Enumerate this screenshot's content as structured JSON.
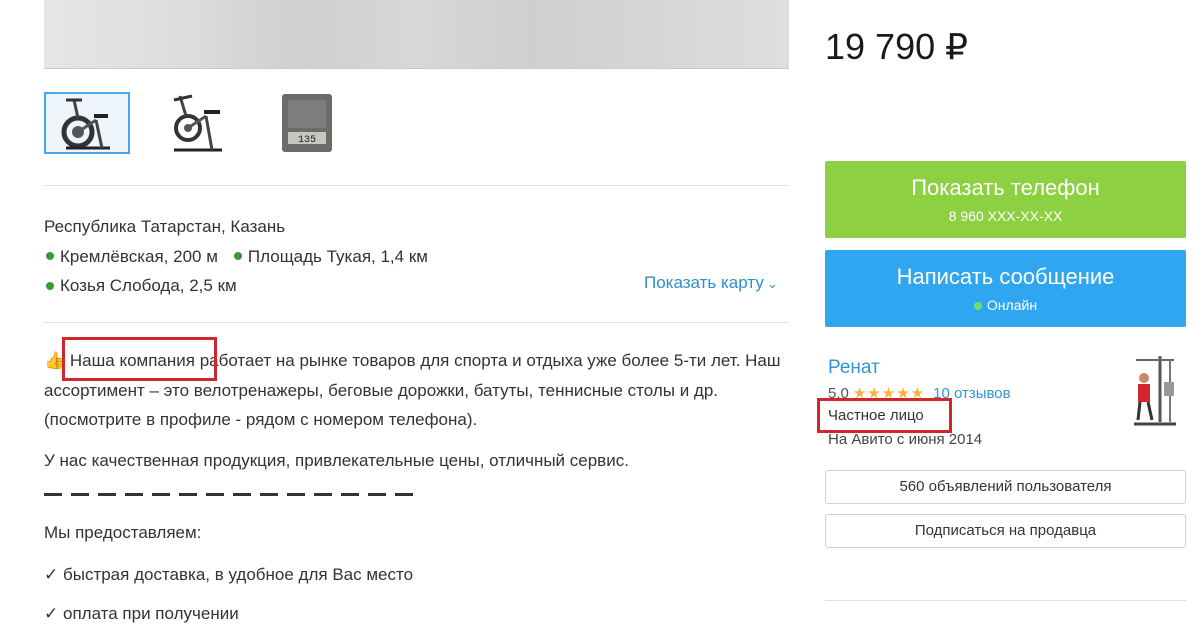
{
  "listing": {
    "price": "19 790 ₽",
    "thumbnails": [
      {
        "name": "exercise-bike-thumb-1",
        "active": true
      },
      {
        "name": "exercise-bike-thumb-2",
        "active": false
      },
      {
        "name": "console-display-thumb",
        "active": false,
        "display_text": "135"
      }
    ],
    "location": {
      "region": "Республика Татарстан, Казань",
      "metro": [
        {
          "label": "Кремлёвская, 200 м",
          "color": "#3a9a37"
        },
        {
          "label": "Площадь Тукая, 1,4 км",
          "color": "#3a9a37"
        },
        {
          "label": "Козья Слобода, 2,5 км",
          "color": "#3a9a37"
        }
      ],
      "show_map_label": "Показать карту",
      "show_map_icon": "chevron-down-icon"
    },
    "description": {
      "emoji": "👍",
      "highlight": "Наша компания",
      "p1_rest": " работает на рынке товаров для спорта и отдыха уже более 5-ти лет. Наш ассортимент – это велотренажеры, беговые дорожки, батуты, теннисные столы и др. (посмотрите в профиле - рядом с номером телефона).",
      "p2": "У нас качественная продукция, привлекательные цены, отличный сервис.",
      "dash_count": 14,
      "p3": "Мы предоставляем:",
      "checks": [
        {
          "mark": "✓",
          "text": "быстрая доставка, в удобное для Вас место"
        },
        {
          "mark": "✓",
          "text": "оплата при получении"
        }
      ]
    }
  },
  "contact": {
    "phone_button": {
      "label": "Показать телефон",
      "sub": "8 960 XXX-XX-XX",
      "color": "#8dd143"
    },
    "message_button": {
      "label": "Написать сообщение",
      "sub": "Онлайн",
      "color": "#2fa6ef"
    }
  },
  "seller": {
    "name": "Ренат",
    "rating": "5.0",
    "stars": "★★★★★",
    "reviews": "10 отзывов",
    "type": "Частное лицо",
    "since": "На Авито с июня 2014",
    "listings_button": "560 объявлений пользователя",
    "subscribe_button": "Подписаться на продавца"
  },
  "colors": {
    "highlight_box": "#d0262c",
    "link": "#3393d4",
    "star": "#fbb03b"
  }
}
